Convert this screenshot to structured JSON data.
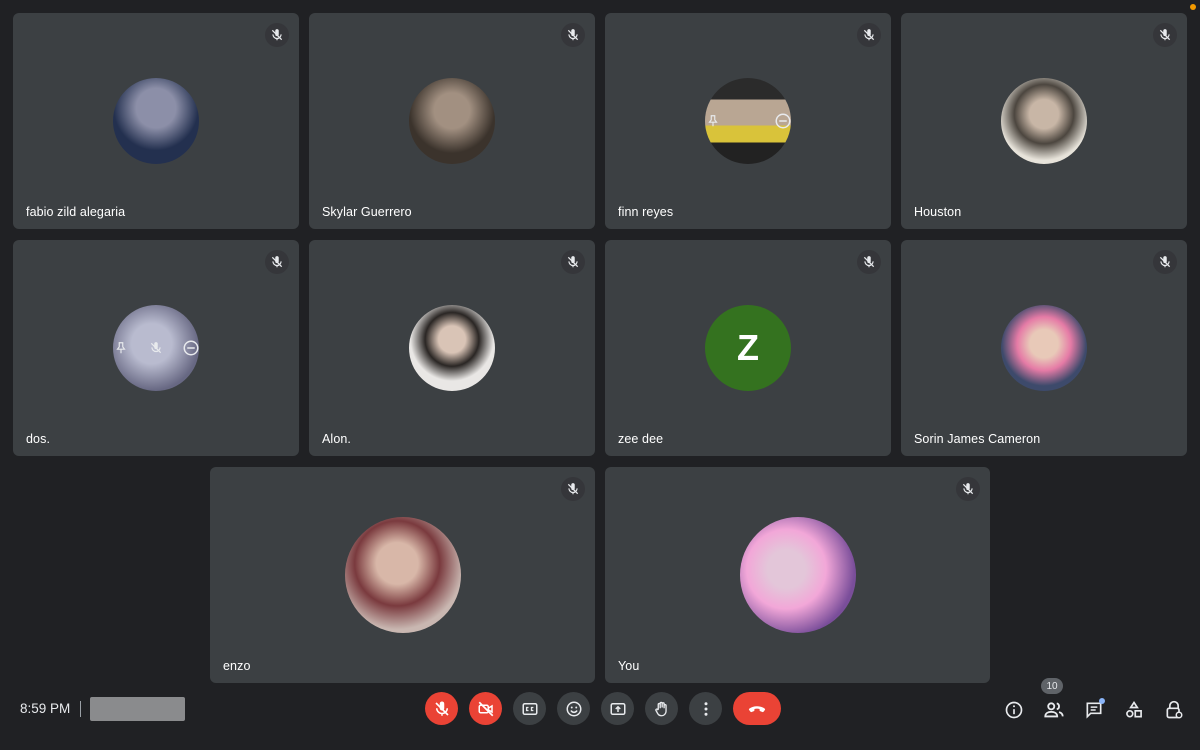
{
  "participants": [
    {
      "name": "fabio zild alegaria",
      "avatar_colors": [
        "#8c8fa8",
        "#23304f"
      ],
      "muted": true
    },
    {
      "name": "Skylar Guerrero",
      "avatar_colors": [
        "#a29081",
        "#3b332c"
      ],
      "muted": true
    },
    {
      "name": "finn reyes",
      "avatar_colors": [
        "#d9c33a",
        "#2b2b2b"
      ],
      "muted": true
    },
    {
      "name": "Houston",
      "avatar_colors": [
        "#e7e3da",
        "#4c463f"
      ],
      "muted": true
    },
    {
      "name": "dos.",
      "avatar_colors": [
        "#cfd1e8",
        "#6f6f8e"
      ],
      "muted": true
    },
    {
      "name": "Alon.",
      "avatar_colors": [
        "#e9e7e5",
        "#2a2624"
      ],
      "muted": true
    },
    {
      "name": "zee dee",
      "avatar_letter": "Z",
      "avatar_bg": "#34721f",
      "muted": true
    },
    {
      "name": "Sorin James Cameron",
      "avatar_colors": [
        "#e57ba6",
        "#3d4a6b"
      ],
      "muted": true
    },
    {
      "name": "enzo",
      "avatar_colors": [
        "#c9b7b1",
        "#7a3a3e"
      ],
      "muted": true
    },
    {
      "name": "You",
      "avatar_colors": [
        "#f2a7d8",
        "#7a4e9a"
      ],
      "muted": true
    }
  ],
  "bottom_bar": {
    "time": "8:59 PM",
    "participant_count": "10"
  },
  "colors": {
    "background": "#202124",
    "tile": "#3c4043",
    "danger": "#ea4335",
    "badge_dot": "#8ab4f8"
  },
  "icons": {
    "controls": [
      "mic-off-icon",
      "camera-off-icon",
      "captions-icon",
      "emoji-icon",
      "present-icon",
      "raise-hand-icon",
      "more-options-icon",
      "end-call-icon"
    ],
    "right_tools": [
      "info-icon",
      "people-icon",
      "chat-icon",
      "activities-icon",
      "host-controls-icon"
    ]
  }
}
